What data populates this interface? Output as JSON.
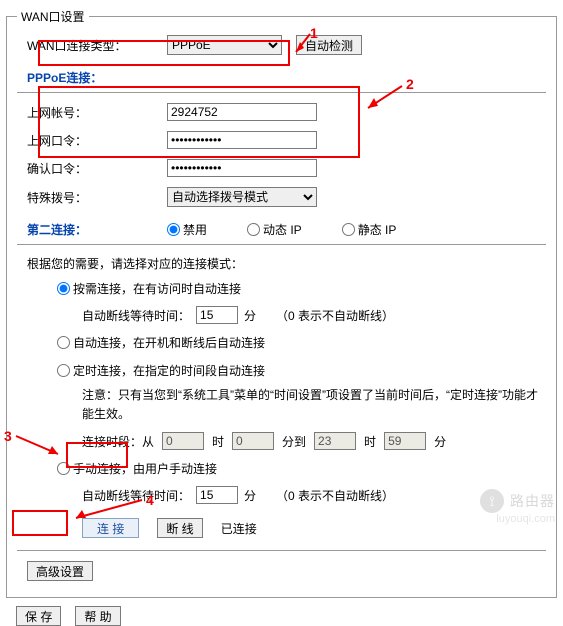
{
  "fieldset_title": "WAN口设置",
  "wan_type_label": "WAN口连接类型：",
  "wan_type_value": "PPPoE",
  "auto_detect_btn": "自动检测",
  "pppoe_section": "PPPoE连接：",
  "account_label": "上网帐号：",
  "account_value": "2924752",
  "password_label": "上网口令：",
  "password_value": "••••••••••••",
  "confirm_label": "确认口令：",
  "confirm_value": "••••••••••••",
  "dial_mode_label": "特殊拨号：",
  "dial_mode_value": "自动选择拨号模式",
  "second_conn_label": "第二连接：",
  "radio_disable": "禁用",
  "radio_dynamic": "动态 IP",
  "radio_static": "静态 IP",
  "mode_hint": "根据您的需要，请选择对应的连接模式：",
  "mode_on_demand": "按需连接，在有访问时自动连接",
  "idle_timeout_label": "自动断线等待时间：",
  "idle_timeout_value": "15",
  "idle_unit": "分",
  "idle_note": "（0 表示不自动断线）",
  "mode_auto": "自动连接，在开机和断线后自动连接",
  "mode_timed": "定时连接，在指定的时间段自动连接",
  "timed_note": "注意：只有当您到“系统工具”菜单的“时间设置”项设置了当前时间后，“定时连接”功能才能生效。",
  "time_range_label": "连接时段：从",
  "time_from_h": "0",
  "time_h_unit": "时",
  "time_from_m": "0",
  "time_m_unit": "分到",
  "time_to_h": "23",
  "time_to_m": "59",
  "time_m_unit2": "分",
  "mode_manual": "手动连接，由用户手动连接",
  "idle2_value": "15",
  "connect_btn": "连 接",
  "disconnect_btn": "断 线",
  "status_text": "已连接",
  "adv_btn": "高级设置",
  "save_btn": "保 存",
  "help_btn": "帮 助",
  "wm_text": "路由器",
  "wm_sub": "luyouqi.com",
  "annot": {
    "n1": "1",
    "n2": "2",
    "n3": "3",
    "n4": "4"
  }
}
